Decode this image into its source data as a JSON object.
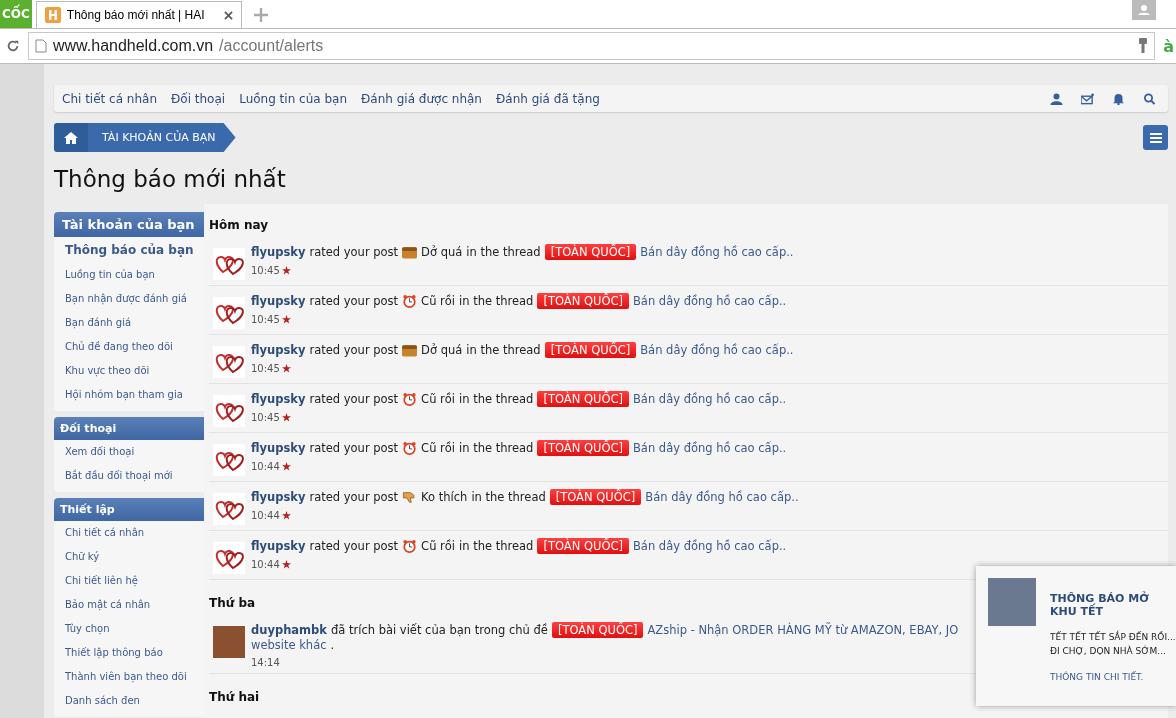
{
  "browser": {
    "app_badge": "CỐC",
    "tab_title": "Thông báo mới nhất | HAI",
    "url_host": "www.handheld.com.vn",
    "url_path": "/account/alerts",
    "extension_label": "à"
  },
  "nav": {
    "links": [
      "Chi tiết cá nhân",
      "Đối thoại",
      "Luồng tin của bạn",
      "Đánh giá được nhận",
      "Đánh giá đã tặng"
    ]
  },
  "breadcrumb": {
    "items": [
      "TÀI KHOẢN CỦA BẠN"
    ]
  },
  "page_title": "Thông báo mới nhất",
  "sidebar": {
    "sections": [
      {
        "heading": "Tài khoản của bạn",
        "items": [
          {
            "label": "Thông báo của bạn",
            "selected": true
          },
          {
            "label": "Luồng tin của bạn",
            "selected": false
          },
          {
            "label": "Bạn nhận được đánh giá",
            "selected": false
          },
          {
            "label": "Bạn đánh giá",
            "selected": false
          },
          {
            "label": "Chủ đề đang theo dõi",
            "selected": false
          },
          {
            "label": "Khu vực theo dõi",
            "selected": false
          },
          {
            "label": "Hội nhóm bạn tham gia",
            "selected": false
          }
        ]
      },
      {
        "heading": "Đối thoại",
        "items": [
          {
            "label": "Xem đối thoại",
            "selected": false
          },
          {
            "label": "Bắt đầu đối thoại mới",
            "selected": false
          }
        ]
      },
      {
        "heading": "Thiết lập",
        "items": [
          {
            "label": "Chi tiết cá nhân",
            "selected": false
          },
          {
            "label": "Chữ ký",
            "selected": false
          },
          {
            "label": "Chi tiết liên hệ",
            "selected": false
          },
          {
            "label": "Bảo mật cá nhân",
            "selected": false
          },
          {
            "label": "Tùy chọn",
            "selected": false
          },
          {
            "label": "Thiết lập thông báo",
            "selected": false
          },
          {
            "label": "Thành viên bạn theo dõi",
            "selected": false
          },
          {
            "label": "Danh sách đen",
            "selected": false
          }
        ]
      }
    ]
  },
  "alerts": {
    "groups": [
      {
        "heading": "Hôm nay",
        "items": [
          {
            "kind": "rating",
            "user": "flyupsky",
            "action": "rated your post",
            "rating": {
              "kind": "box",
              "label": "Dở quá"
            },
            "connector": "in the thread",
            "prefix": "[TOÀN QUỐC]",
            "thread": "Bán dây đồng hồ cao cấp..",
            "time": "10:45"
          },
          {
            "kind": "rating",
            "user": "flyupsky",
            "action": "rated your post",
            "rating": {
              "kind": "clock",
              "label": "Cũ rồi"
            },
            "connector": "in the thread",
            "prefix": "[TOÀN QUỐC]",
            "thread": "Bán dây đồng hồ cao cấp..",
            "time": "10:45"
          },
          {
            "kind": "rating",
            "user": "flyupsky",
            "action": "rated your post",
            "rating": {
              "kind": "box",
              "label": "Dở quá"
            },
            "connector": "in the thread",
            "prefix": "[TOÀN QUỐC]",
            "thread": "Bán dây đồng hồ cao cấp..",
            "time": "10:45"
          },
          {
            "kind": "rating",
            "user": "flyupsky",
            "action": "rated your post",
            "rating": {
              "kind": "clock",
              "label": "Cũ rồi"
            },
            "connector": "in the thread",
            "prefix": "[TOÀN QUỐC]",
            "thread": "Bán dây đồng hồ cao cấp..",
            "time": "10:45"
          },
          {
            "kind": "rating",
            "user": "flyupsky",
            "action": "rated your post",
            "rating": {
              "kind": "clock",
              "label": "Cũ rồi"
            },
            "connector": "in the thread",
            "prefix": "[TOÀN QUỐC]",
            "thread": "Bán dây đồng hồ cao cấp..",
            "time": "10:44"
          },
          {
            "kind": "rating",
            "user": "flyupsky",
            "action": "rated your post",
            "rating": {
              "kind": "thumb_down",
              "label": "Ko thích"
            },
            "connector": "in the thread",
            "prefix": "[TOÀN QUỐC]",
            "thread": "Bán dây đồng hồ cao cấp..",
            "time": "10:44"
          },
          {
            "kind": "rating",
            "user": "flyupsky",
            "action": "rated your post",
            "rating": {
              "kind": "clock",
              "label": "Cũ rồi"
            },
            "connector": "in the thread",
            "prefix": "[TOÀN QUỐC]",
            "thread": "Bán dây đồng hồ cao cấp..",
            "time": "10:44"
          }
        ]
      },
      {
        "heading": "Thứ ba",
        "items": [
          {
            "kind": "quote",
            "user": "duyphambk",
            "action": "đã trích bài viết của bạn trong chủ đề",
            "prefix": "[TOÀN QUỐC]",
            "thread": "AZship - Nhận ORDER HÀNG MỸ từ AMAZON, EBAY, JO",
            "thread_continued": "website khác",
            "end": ".",
            "time": "14:14"
          }
        ]
      },
      {
        "heading": "Thứ hai"
      }
    ]
  },
  "popup": {
    "title": "THÔNG BÁO MỞ KHU TẾT",
    "body_lines": [
      "TẾT TẾT TẾT SẮP ĐẾN RỒI...",
      "ĐI CHỢ, DỌN NHÀ SỚM..."
    ],
    "link": "THÔNG TIN CHI TIẾT."
  }
}
